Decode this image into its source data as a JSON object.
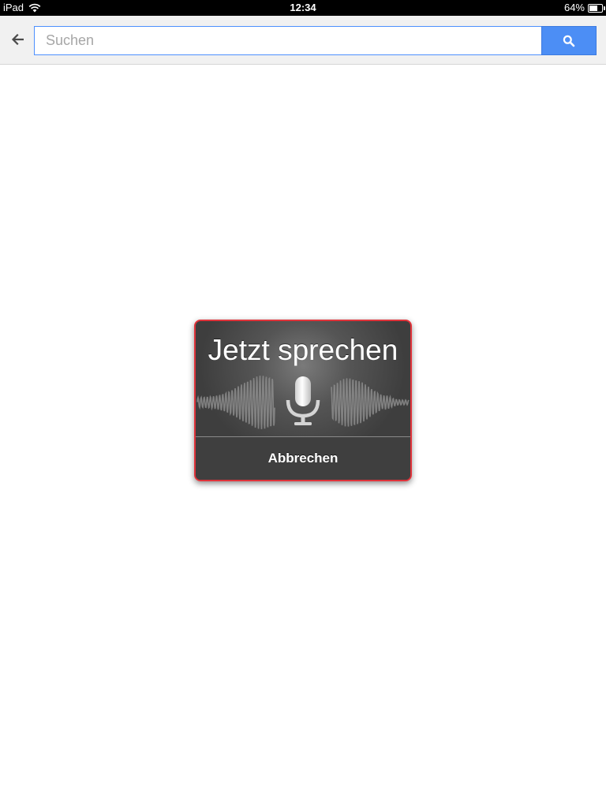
{
  "status_bar": {
    "carrier": "iPad",
    "time": "12:34",
    "battery": "64%",
    "battery_level": 0.64,
    "wifi_icon": "wifi-icon",
    "battery_icon": "battery-icon"
  },
  "toolbar": {
    "back_icon": "back-arrow-icon",
    "search_placeholder": "Suchen",
    "search_value": "",
    "search_icon": "search-icon",
    "accent_color": "#4c8ef5"
  },
  "voice_dialog": {
    "title": "Jetzt sprechen",
    "mic_icon": "microphone-icon",
    "cancel_label": "Abbrechen",
    "border_color": "#e0333a"
  }
}
